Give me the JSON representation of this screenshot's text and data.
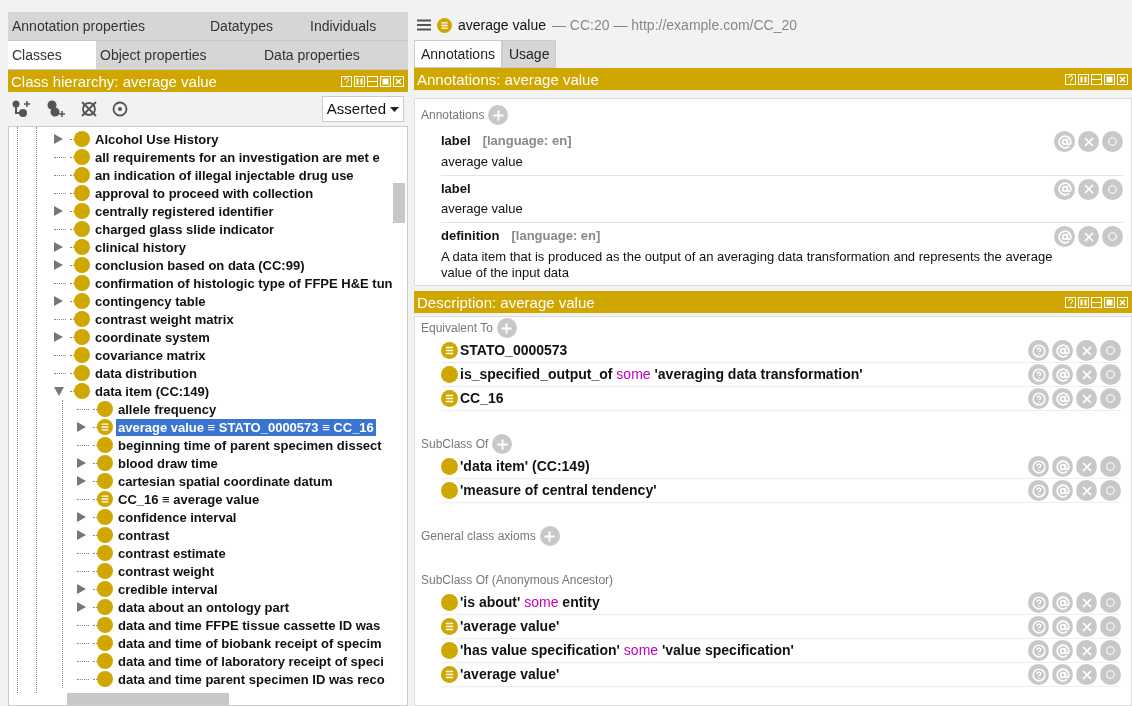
{
  "left": {
    "tab_rows": [
      [
        {
          "label": "Annotation properties",
          "selected": false
        },
        {
          "label": "Datatypes",
          "selected": false
        },
        {
          "label": "Individuals",
          "selected": false
        }
      ],
      [
        {
          "label": "Classes",
          "selected": true
        },
        {
          "label": "Object properties",
          "selected": false
        },
        {
          "label": "Data properties",
          "selected": false
        }
      ]
    ],
    "hierarchy_title": "Class hierarchy: average value",
    "view_mode": "Asserted",
    "tree": [
      {
        "label": "Alcohol Use History",
        "kind": "class",
        "has_children": true,
        "expanded": false,
        "selected": false
      },
      {
        "label": "all requirements for an investigation are met e",
        "kind": "class",
        "has_children": false,
        "selected": false
      },
      {
        "label": "an indication of illegal injectable drug use",
        "kind": "class",
        "has_children": false,
        "selected": false
      },
      {
        "label": "approval to proceed with collection",
        "kind": "class",
        "has_children": false,
        "selected": false
      },
      {
        "label": "centrally registered identifier",
        "kind": "class",
        "has_children": true,
        "expanded": false,
        "selected": false
      },
      {
        "label": "charged glass slide indicator",
        "kind": "class",
        "has_children": false,
        "selected": false
      },
      {
        "label": "clinical history",
        "kind": "class",
        "has_children": true,
        "expanded": false,
        "selected": false
      },
      {
        "label": "conclusion based on data (CC:99)",
        "kind": "class",
        "has_children": true,
        "expanded": false,
        "selected": false
      },
      {
        "label": "confirmation of histologic type of FFPE H&E tun",
        "kind": "class",
        "has_children": false,
        "selected": false
      },
      {
        "label": "contingency table",
        "kind": "class",
        "has_children": true,
        "expanded": false,
        "selected": false
      },
      {
        "label": "contrast weight matrix",
        "kind": "class",
        "has_children": false,
        "selected": false
      },
      {
        "label": "coordinate system",
        "kind": "class",
        "has_children": true,
        "expanded": false,
        "selected": false
      },
      {
        "label": "covariance matrix",
        "kind": "class",
        "has_children": false,
        "selected": false
      },
      {
        "label": "data distribution",
        "kind": "class",
        "has_children": false,
        "selected": false
      },
      {
        "label": "data item (CC:149)",
        "kind": "class",
        "has_children": true,
        "expanded": true,
        "selected": false,
        "children": [
          {
            "label": "allele frequency",
            "kind": "class",
            "has_children": false,
            "selected": false
          },
          {
            "label": "average value ≡ STATO_0000573 ≡ CC_16",
            "kind": "equivalent",
            "has_children": true,
            "expanded": false,
            "selected": true
          },
          {
            "label": "beginning time of parent specimen dissect",
            "kind": "class",
            "has_children": false,
            "selected": false
          },
          {
            "label": "blood draw time",
            "kind": "class",
            "has_children": true,
            "expanded": false,
            "selected": false
          },
          {
            "label": "cartesian spatial coordinate datum",
            "kind": "class",
            "has_children": true,
            "expanded": false,
            "selected": false
          },
          {
            "label": "CC_16 ≡ average value",
            "kind": "equivalent",
            "has_children": false,
            "selected": false
          },
          {
            "label": "confidence interval",
            "kind": "class",
            "has_children": true,
            "expanded": false,
            "selected": false
          },
          {
            "label": "contrast",
            "kind": "class",
            "has_children": true,
            "expanded": false,
            "selected": false
          },
          {
            "label": "contrast estimate",
            "kind": "class",
            "has_children": false,
            "selected": false
          },
          {
            "label": "contrast weight",
            "kind": "class",
            "has_children": false,
            "selected": false
          },
          {
            "label": "credible interval",
            "kind": "class",
            "has_children": true,
            "expanded": false,
            "selected": false
          },
          {
            "label": "data about an ontology part",
            "kind": "class",
            "has_children": true,
            "expanded": false,
            "selected": false
          },
          {
            "label": "data and time FFPE tissue cassette ID was",
            "kind": "class",
            "has_children": false,
            "selected": false
          },
          {
            "label": "data and time of biobank receipt of specim",
            "kind": "class",
            "has_children": false,
            "selected": false
          },
          {
            "label": "data and time of laboratory receipt of speci",
            "kind": "class",
            "has_children": false,
            "selected": false
          },
          {
            "label": "data and time parent specimen ID was reco",
            "kind": "class",
            "has_children": false,
            "selected": false
          }
        ]
      }
    ]
  },
  "right": {
    "entity": {
      "name": "average value",
      "details": "— CC:20 — http://example.com/CC_20"
    },
    "tabs": [
      {
        "label": "Annotations",
        "selected": true
      },
      {
        "label": "Usage",
        "selected": false
      }
    ],
    "annotations_title": "Annotations: average value",
    "annotations_heading": "Annotations",
    "annotations": [
      {
        "property": "label",
        "language": "[language: en]",
        "value": "average value"
      },
      {
        "property": "label",
        "value": "average value"
      },
      {
        "property": "definition",
        "language": "[language: en]",
        "value": "A  data item that is produced as the output of an averaging data transformation and represents the average value of the input data"
      }
    ],
    "description_title": "Description: average value",
    "sections": [
      {
        "heading": "Equivalent To",
        "addable": true,
        "items": [
          {
            "kind": "equivalent",
            "tokens": [
              {
                "kind": "name",
                "text": "STATO_0000573"
              }
            ]
          },
          {
            "kind": "class",
            "tokens": [
              {
                "kind": "name",
                "text": "is_specified_output_of"
              },
              {
                "kind": "keyword",
                "text": "some"
              },
              {
                "kind": "name",
                "text": "'averaging data transformation'"
              }
            ]
          },
          {
            "kind": "equivalent",
            "tokens": [
              {
                "kind": "name",
                "text": "CC_16"
              }
            ]
          }
        ]
      },
      {
        "heading": "SubClass Of",
        "addable": true,
        "items": [
          {
            "kind": "class",
            "tokens": [
              {
                "kind": "name",
                "text": "'data item' (CC:149)"
              }
            ]
          },
          {
            "kind": "class",
            "tokens": [
              {
                "kind": "name",
                "text": "'measure of central tendency'"
              }
            ]
          }
        ]
      },
      {
        "heading": "General class axioms",
        "addable": true
      },
      {
        "heading": "SubClass Of (Anonymous Ancestor)",
        "addable": false,
        "items": [
          {
            "kind": "class",
            "tokens": [
              {
                "kind": "name",
                "text": "'is about'"
              },
              {
                "kind": "keyword",
                "text": "some"
              },
              {
                "kind": "name",
                "text": "entity"
              }
            ]
          },
          {
            "kind": "equivalent",
            "tokens": [
              {
                "kind": "name",
                "text": "'average value'"
              }
            ]
          },
          {
            "kind": "class",
            "tokens": [
              {
                "kind": "name",
                "text": "'has value specification'"
              },
              {
                "kind": "keyword",
                "text": "some"
              },
              {
                "kind": "name",
                "text": "'value specification'"
              }
            ]
          },
          {
            "kind": "equivalent",
            "tokens": [
              {
                "kind": "name",
                "text": "'average value'"
              }
            ]
          }
        ]
      }
    ]
  }
}
